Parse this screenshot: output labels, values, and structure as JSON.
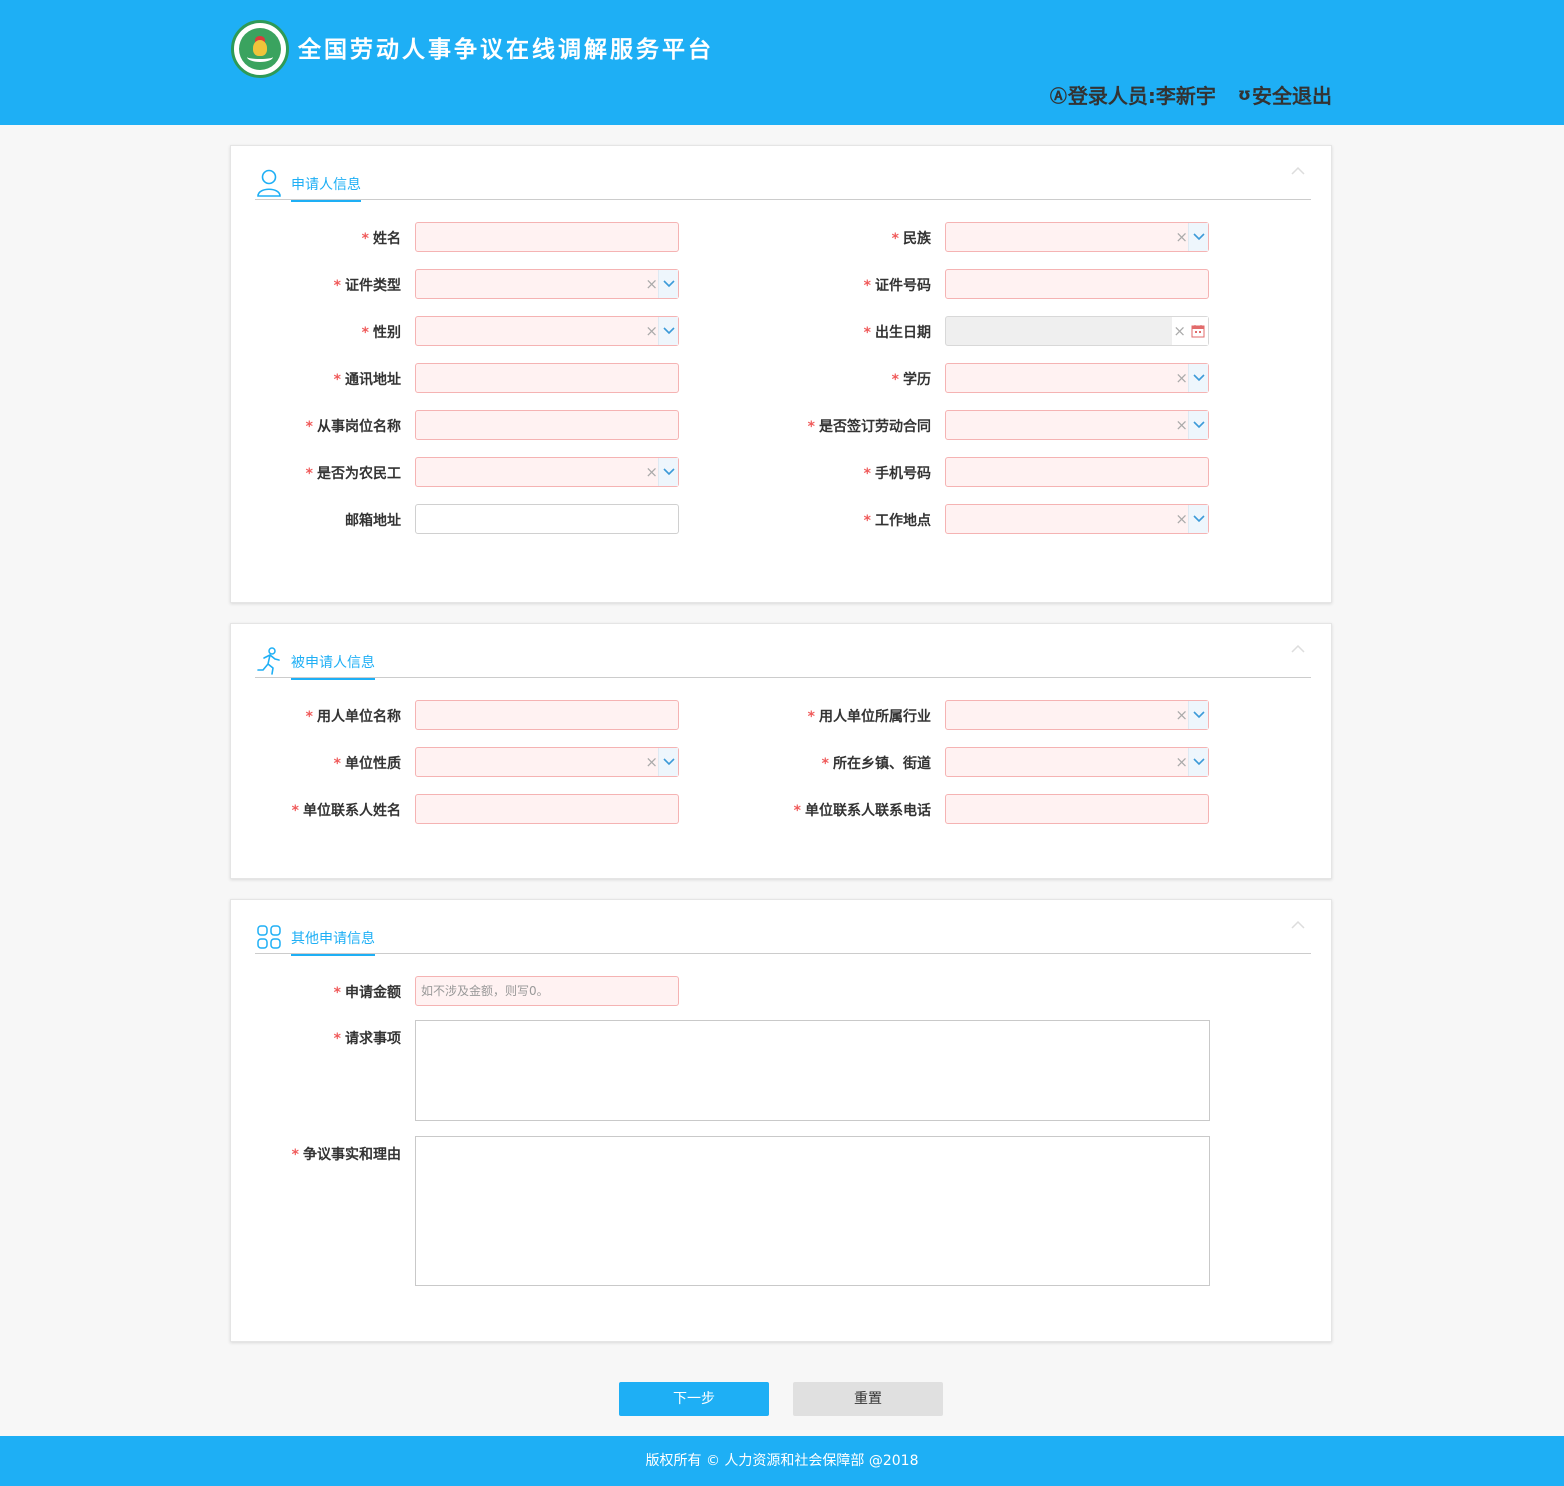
{
  "header": {
    "title": "全国劳动人事争议在线调解服务平台",
    "user_icon": "Ⓐ",
    "user_label": "登录人员:李新宇",
    "logout_icon": "ʊ",
    "logout_label": "安全退出"
  },
  "applicant": {
    "title": "申请人信息",
    "left": [
      {
        "label": "姓名",
        "required": true,
        "type": "text"
      },
      {
        "label": "证件类型",
        "required": true,
        "type": "select"
      },
      {
        "label": "性别",
        "required": true,
        "type": "select"
      },
      {
        "label": "通讯地址",
        "required": true,
        "type": "text"
      },
      {
        "label": "从事岗位名称",
        "required": true,
        "type": "text"
      },
      {
        "label": "是否为农民工",
        "required": true,
        "type": "select"
      },
      {
        "label": "邮箱地址",
        "required": false,
        "type": "text"
      }
    ],
    "right": [
      {
        "label": "民族",
        "required": true,
        "type": "select"
      },
      {
        "label": "证件号码",
        "required": true,
        "type": "text"
      },
      {
        "label": "出生日期",
        "required": true,
        "type": "date"
      },
      {
        "label": "学历",
        "required": true,
        "type": "select"
      },
      {
        "label": "是否签订劳动合同",
        "required": true,
        "type": "select"
      },
      {
        "label": "手机号码",
        "required": true,
        "type": "text"
      },
      {
        "label": "工作地点",
        "required": true,
        "type": "select"
      }
    ]
  },
  "respondent": {
    "title": "被申请人信息",
    "left": [
      {
        "label": "用人单位名称",
        "required": true,
        "type": "text"
      },
      {
        "label": "单位性质",
        "required": true,
        "type": "select"
      },
      {
        "label": "单位联系人姓名",
        "required": true,
        "type": "text"
      }
    ],
    "right": [
      {
        "label": "用人单位所属行业",
        "required": true,
        "type": "select"
      },
      {
        "label": "所在乡镇、街道",
        "required": true,
        "type": "select"
      },
      {
        "label": "单位联系人联系电话",
        "required": true,
        "type": "text"
      }
    ]
  },
  "other": {
    "title": "其他申请信息",
    "amount_label": "申请金额",
    "amount_placeholder": "如不涉及金额，则写0。",
    "claims_label": "请求事项",
    "facts_label": "争议事实和理由"
  },
  "buttons": {
    "next": "下一步",
    "reset": "重置"
  },
  "footer": {
    "text": "版权所有 © 人力资源和社会保障部 @2018"
  },
  "colors": {
    "brand": "#1eaff5",
    "required": "#f05a5a",
    "invalid_border": "#f5b3b3",
    "invalid_bg": "#fff2f2"
  },
  "icons": {
    "applicant": "user-icon",
    "respondent": "running-person-icon",
    "other": "grid-icon",
    "select": "chevron-down-icon",
    "clear": "close-icon",
    "date": "calendar-icon"
  }
}
